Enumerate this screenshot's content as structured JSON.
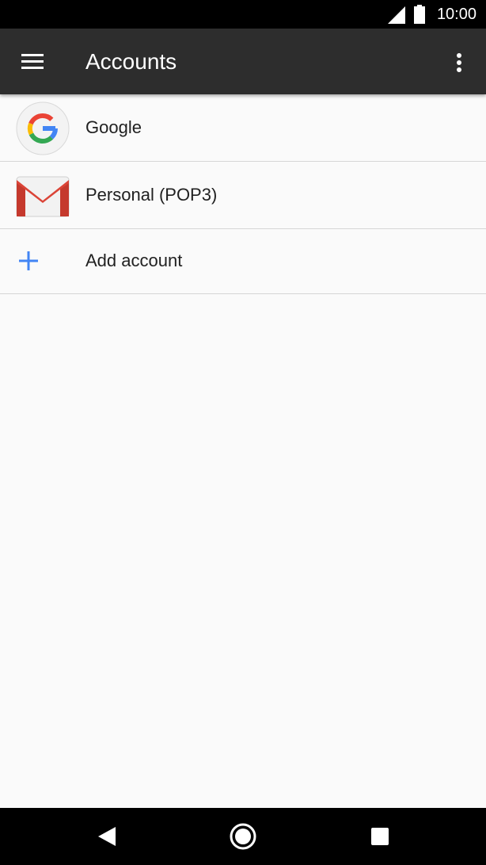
{
  "status_bar": {
    "time": "10:00",
    "icons": [
      "signal-icon",
      "battery-icon"
    ]
  },
  "app_bar": {
    "title": "Accounts",
    "menu_icon": "menu-icon",
    "overflow_icon": "more-vert-icon"
  },
  "accounts": [
    {
      "label": "Google",
      "icon": "google-icon"
    },
    {
      "label": "Personal (POP3)",
      "icon": "gmail-icon"
    }
  ],
  "add_account": {
    "label": "Add account",
    "icon": "plus-icon",
    "accent": "#4285f4"
  },
  "nav_bar": {
    "icons": [
      "back-icon",
      "home-icon",
      "recents-icon"
    ]
  },
  "colors": {
    "app_bar": "#2d2d2d",
    "background": "#fafafa",
    "status_bar": "#000000"
  }
}
